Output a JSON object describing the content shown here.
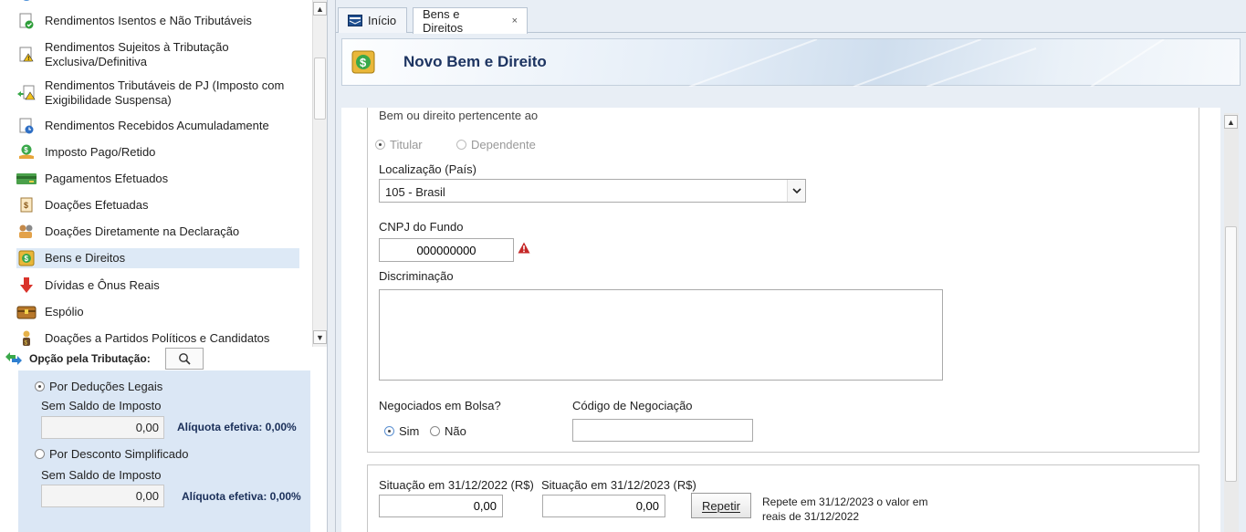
{
  "nav": {
    "items": [
      {
        "label": "Rendimentos Isentos e Não Tributáveis",
        "icon": "exempt-income-icon"
      },
      {
        "label": "Rendimentos Sujeitos à Tributação Exclusiva/Definitiva",
        "icon": "exclusive-tax-icon"
      },
      {
        "label": "Rendimentos Tributáveis de PJ (Imposto com Exigibilidade Suspensa)",
        "icon": "suspended-tax-icon"
      },
      {
        "label": "Rendimentos Recebidos Acumuladamente",
        "icon": "accumulated-income-icon"
      },
      {
        "label": "Imposto Pago/Retido",
        "icon": "tax-paid-icon"
      },
      {
        "label": "Pagamentos Efetuados",
        "icon": "payments-card-icon"
      },
      {
        "label": "Doações Efetuadas",
        "icon": "donations-icon"
      },
      {
        "label": "Doações Diretamente na Declaração",
        "icon": "direct-donations-icon"
      },
      {
        "label": "Bens e Direitos",
        "icon": "assets-icon"
      },
      {
        "label": "Dívidas e Ônus Reais",
        "icon": "debts-icon"
      },
      {
        "label": "Espólio",
        "icon": "estate-chest-icon"
      },
      {
        "label": "Doações a Partidos Políticos e Candidatos",
        "icon": "political-donations-icon"
      }
    ],
    "selected": "Bens e Direitos"
  },
  "tax_option": {
    "label": "Opção pela Tributação:",
    "legal": {
      "label": "Por Deduções Legais",
      "status": "Sem Saldo de Imposto",
      "value": "0,00",
      "aliquota": "Alíquota efetiva: 0,00%"
    },
    "simple": {
      "label": "Por Desconto Simplificado",
      "status": "Sem Saldo de Imposto",
      "value": "0,00",
      "aliquota": "Alíquota efetiva: 0,00%"
    }
  },
  "tabs": {
    "home": "Início",
    "current": "Bens e Direitos",
    "close": "×"
  },
  "form": {
    "title": "Novo Bem e Direito",
    "belongs_label": "Bem ou direito pertencente ao",
    "owner_titular": "Titular",
    "owner_dependente": "Dependente",
    "location_label": "Localização (País)",
    "location_value": "105 - Brasil",
    "cnpj_label": "CNPJ do Fundo",
    "cnpj_value": "000000000",
    "discriminacao_label": "Discriminação",
    "discriminacao_value": "",
    "negociados_label": "Negociados em Bolsa?",
    "sim": "Sim",
    "nao": "Não",
    "codigo_label": "Código de Negociação",
    "codigo_value": "",
    "sit2022_label": "Situação em 31/12/2022 (R$)",
    "sit2022_value": "0,00",
    "sit2023_label": "Situação em 31/12/2023 (R$)",
    "sit2023_value": "0,00",
    "repetir_label": "Repetir",
    "repetir_hint": "Repete em 31/12/2023 o valor em reais de 31/12/2022"
  },
  "colors": {
    "accent": "#1d3461",
    "selection": "#dde9f6",
    "tax_box": "#dbe7f5",
    "warning": "#c62828"
  }
}
